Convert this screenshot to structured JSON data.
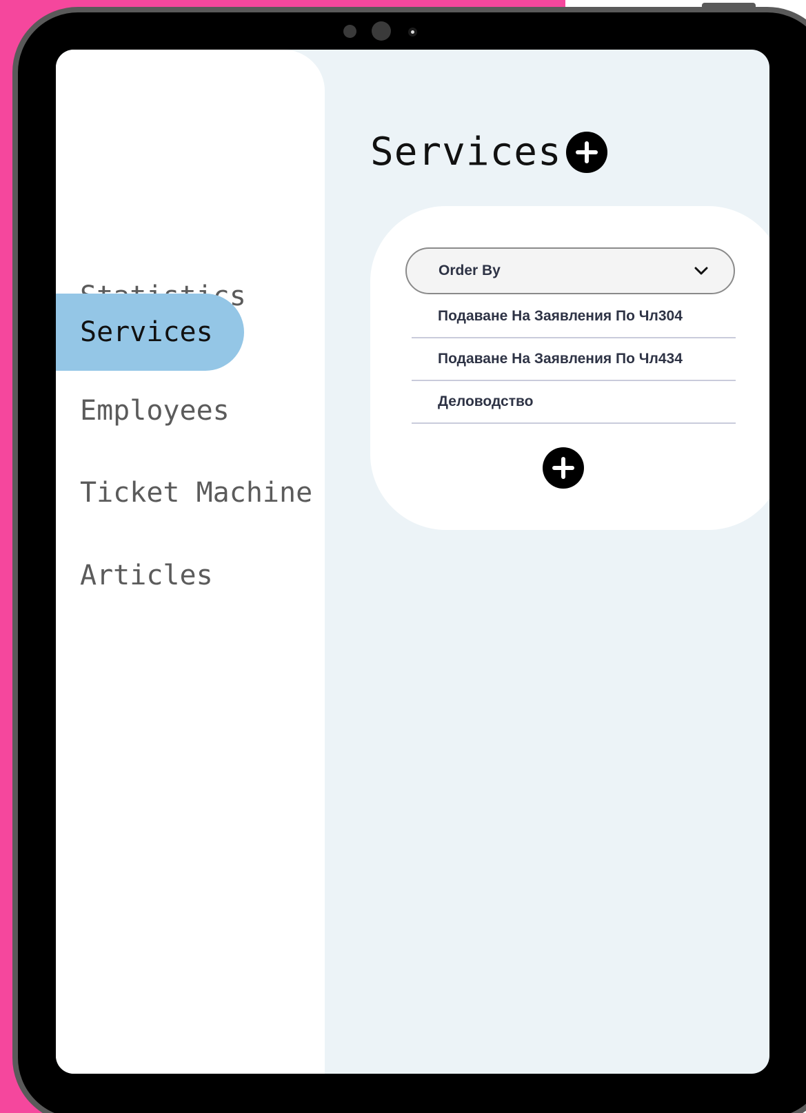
{
  "sidebar": {
    "items": [
      {
        "label": "Statistics",
        "active": false
      },
      {
        "label": "Services",
        "active": true
      },
      {
        "label": "Employees",
        "active": false
      },
      {
        "label": "Ticket Machine",
        "active": false
      },
      {
        "label": "Articles",
        "active": false
      }
    ]
  },
  "main": {
    "title": "Services",
    "title_action_icon": "plus-circle-icon",
    "order_by": {
      "label": "Order By",
      "icon": "chevron-down-icon"
    },
    "services": [
      {
        "name": "Подаване На Заявления По Чл304"
      },
      {
        "name": "Подаване На Заявления По Чл434"
      },
      {
        "name": "Деловодство"
      }
    ],
    "add_icon": "plus-circle-icon"
  },
  "colors": {
    "background": "#f5479d",
    "device_frame": "#000000",
    "content_bg": "#ecf3f7",
    "active_nav": "#94c6e6",
    "text_dark": "#2e3345"
  }
}
